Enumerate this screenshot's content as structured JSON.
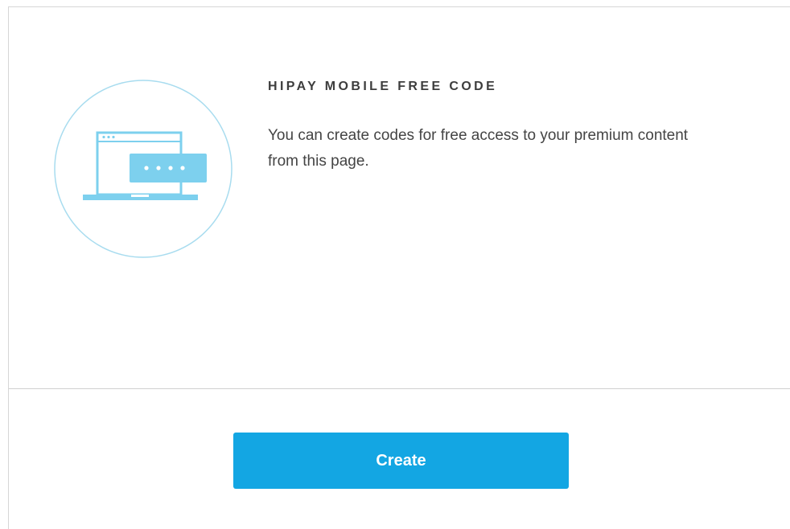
{
  "panel": {
    "title": "HIPAY MOBILE FREE CODE",
    "description": "You can create codes for free access to your premium content from this page.",
    "illustration_icon": "laptop-code-icon"
  },
  "footer": {
    "create_label": "Create"
  },
  "colors": {
    "accent": "#13a6e3",
    "illustration": "#7dd0ee",
    "illustration_ring": "#a8dcef",
    "title_text": "#3d3d3d",
    "body_text": "#444444",
    "divider": "#d0d0d0"
  }
}
